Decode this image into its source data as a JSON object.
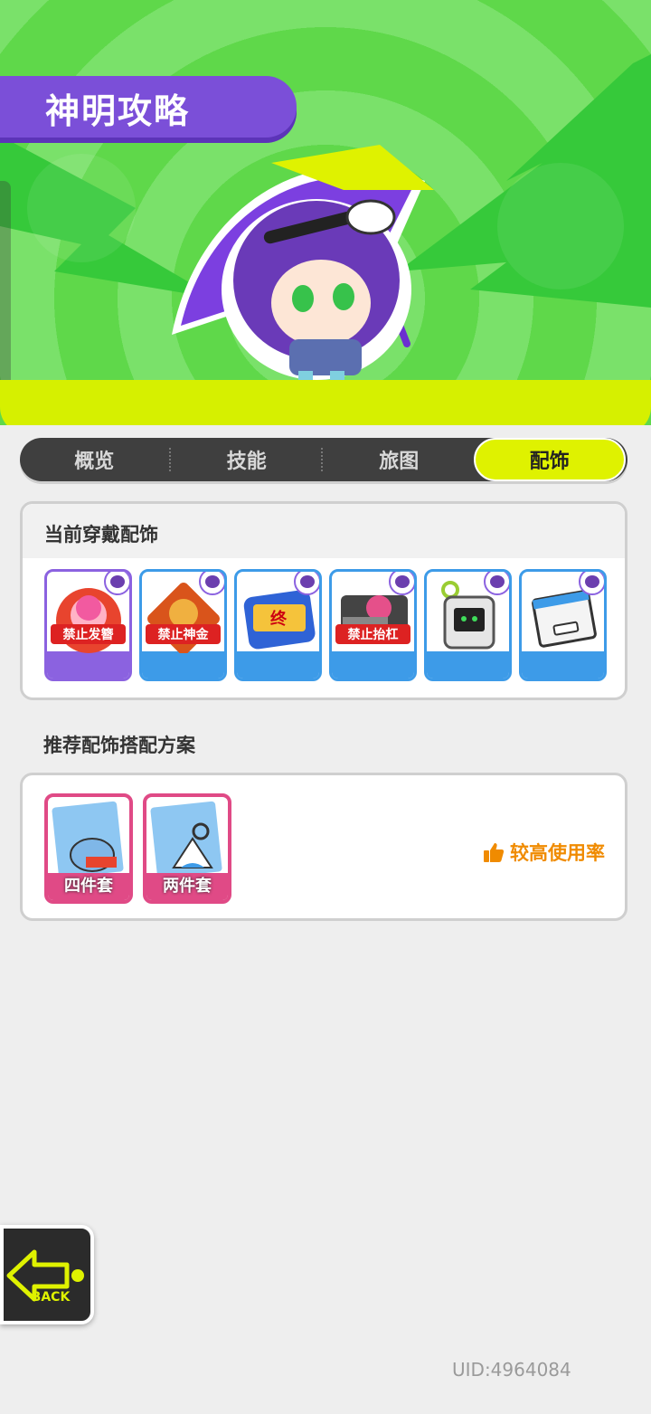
{
  "header": {
    "title": "神明攻略"
  },
  "tabs": [
    {
      "label": "概览",
      "active": false
    },
    {
      "label": "技能",
      "active": false
    },
    {
      "label": "旅图",
      "active": false
    },
    {
      "label": "配饰",
      "active": true
    }
  ],
  "current_accessories": {
    "title": "当前穿戴配饰",
    "items": [
      {
        "caption": "禁止发簪",
        "color": "purple"
      },
      {
        "caption": "禁止神金",
        "color": "blue"
      },
      {
        "caption": "",
        "color": "blue"
      },
      {
        "caption": "禁止抬杠",
        "color": "blue"
      },
      {
        "caption": "",
        "color": "blue"
      },
      {
        "caption": "",
        "color": "blue"
      }
    ]
  },
  "recommended": {
    "title": "推荐配饰搭配方案",
    "sets": [
      {
        "label": "四件套"
      },
      {
        "label": "两件套"
      }
    ],
    "usage_label": "较高使用率"
  },
  "footer": {
    "back_label": "BACK",
    "uid": "UID:4964084"
  },
  "colors": {
    "accent_lime": "#dff200",
    "purple": "#7b4fd8",
    "blue": "#3d9be8",
    "pink": "#e04a86",
    "orange": "#f08b00"
  }
}
